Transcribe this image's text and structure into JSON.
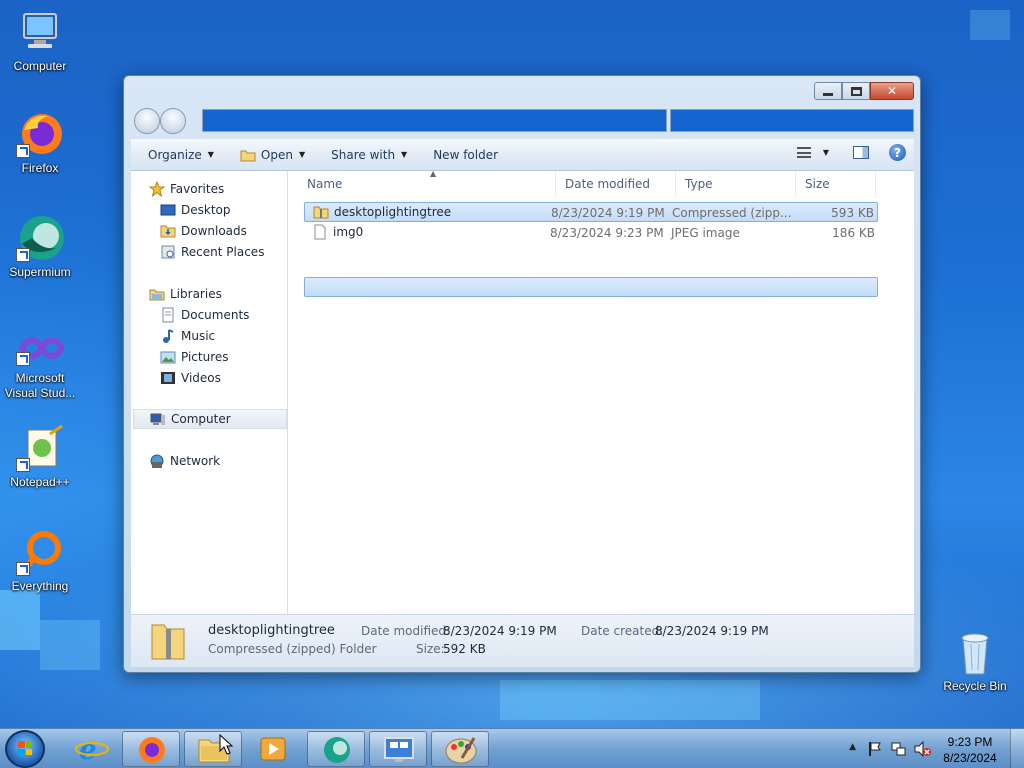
{
  "desktop": {
    "icons": [
      {
        "label": "Computer"
      },
      {
        "label": "Firefox"
      },
      {
        "label": "Supermium"
      },
      {
        "label": "Microsoft Visual Stud..."
      },
      {
        "label": "Notepad++"
      },
      {
        "label": "Everything"
      },
      {
        "label": "Recycle Bin"
      }
    ]
  },
  "window": {
    "toolbar": {
      "organize": "Organize",
      "open": "Open",
      "share_with": "Share with",
      "new_folder": "New folder"
    },
    "nav": {
      "favorites": "Favorites",
      "desktop": "Desktop",
      "downloads": "Downloads",
      "recent_places": "Recent Places",
      "libraries": "Libraries",
      "documents": "Documents",
      "music": "Music",
      "pictures": "Pictures",
      "videos": "Videos",
      "computer": "Computer",
      "network": "Network"
    },
    "columns": {
      "name": "Name",
      "date_modified": "Date modified",
      "type": "Type",
      "size": "Size"
    },
    "files": [
      {
        "name": "desktoplightingtree",
        "date": "8/23/2024 9:19 PM",
        "type": "Compressed (zipp...",
        "size": "593 KB",
        "selected": true
      },
      {
        "name": "img0",
        "date": "8/23/2024 9:23 PM",
        "type": "JPEG image",
        "size": "186 KB",
        "selected": false
      }
    ],
    "details": {
      "name": "desktoplightingtree",
      "type": "Compressed (zipped) Folder",
      "date_modified_label": "Date modified:",
      "date_modified": "8/23/2024 9:19 PM",
      "date_created_label": "Date created:",
      "date_created": "8/23/2024 9:19 PM",
      "size_label": "Size:",
      "size": "592 KB"
    }
  },
  "taskbar": {
    "clock_time": "9:23 PM",
    "clock_date": "8/23/2024"
  },
  "colors": {
    "address_bar": "#1565d0",
    "selection": "#c4dcf8",
    "desktop": "#1d6fd3"
  }
}
